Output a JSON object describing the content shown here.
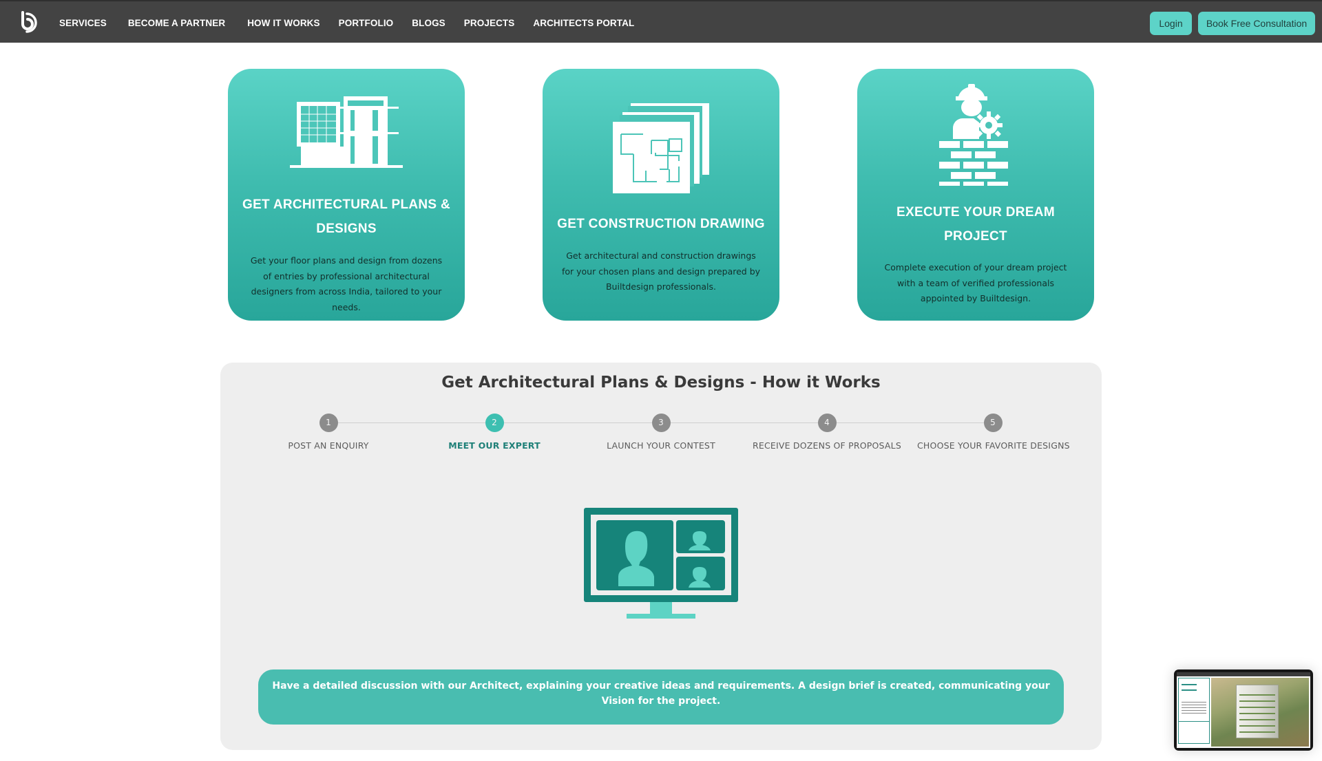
{
  "navbar": {
    "logo_icon": "builtdesign-logo-icon",
    "links": [
      {
        "label": "SERVICES"
      },
      {
        "label": "BECOME A PARTNER"
      },
      {
        "label": "HOW IT WORKS"
      },
      {
        "label": "PORTFOLIO"
      },
      {
        "label": "BLOGS"
      },
      {
        "label": "PROJECTS"
      },
      {
        "label": "ARCHITECTS PORTAL"
      }
    ],
    "login_label": "Login",
    "consultation_label": "Book Free Consultation"
  },
  "colors": {
    "navbar_bg": "#434343",
    "accent": "#5dd3c8",
    "card_gradient_top": "#5ad3c6",
    "card_gradient_bottom": "#28a69a",
    "active_step": "#3dbfb1",
    "inactive_step": "#8c8c8c",
    "panel_bg": "#eeeeee"
  },
  "services": [
    {
      "icon": "building-icon",
      "title": "GET ARCHITECTURAL PLANS & DESIGNS",
      "description": "Get your floor plans and design from dozens of entries by professional architectural designers from across India, tailored to your needs."
    },
    {
      "icon": "floor-plan-icon",
      "title": "GET CONSTRUCTION DRAWING",
      "description": "Get architectural and construction drawings for your chosen plans and design prepared by Builtdesign professionals."
    },
    {
      "icon": "construction-worker-icon",
      "title": "EXECUTE YOUR DREAM PROJECT",
      "description": "Complete execution of your dream project with a team of verified professionals appointed by Builtdesign."
    }
  ],
  "how_it_works": {
    "title": "Get Architectural Plans & Designs - How it Works",
    "active_step": 2,
    "steps": [
      {
        "number": "1",
        "label": "POST AN ENQUIRY"
      },
      {
        "number": "2",
        "label": "MEET OUR EXPERT"
      },
      {
        "number": "3",
        "label": "LAUNCH YOUR CONTEST"
      },
      {
        "number": "4",
        "label": "RECEIVE DOZENS OF PROPOSALS"
      },
      {
        "number": "5",
        "label": "CHOOSE YOUR FAVORITE DESIGNS"
      }
    ],
    "illustration_icon": "video-call-monitor-icon",
    "step_description": "Have a detailed discussion with our Architect, explaining your creative ideas and requirements. A design brief is created, communicating your Vision for the project."
  },
  "preview_widget": {
    "icon": "website-preview-thumbnail"
  }
}
